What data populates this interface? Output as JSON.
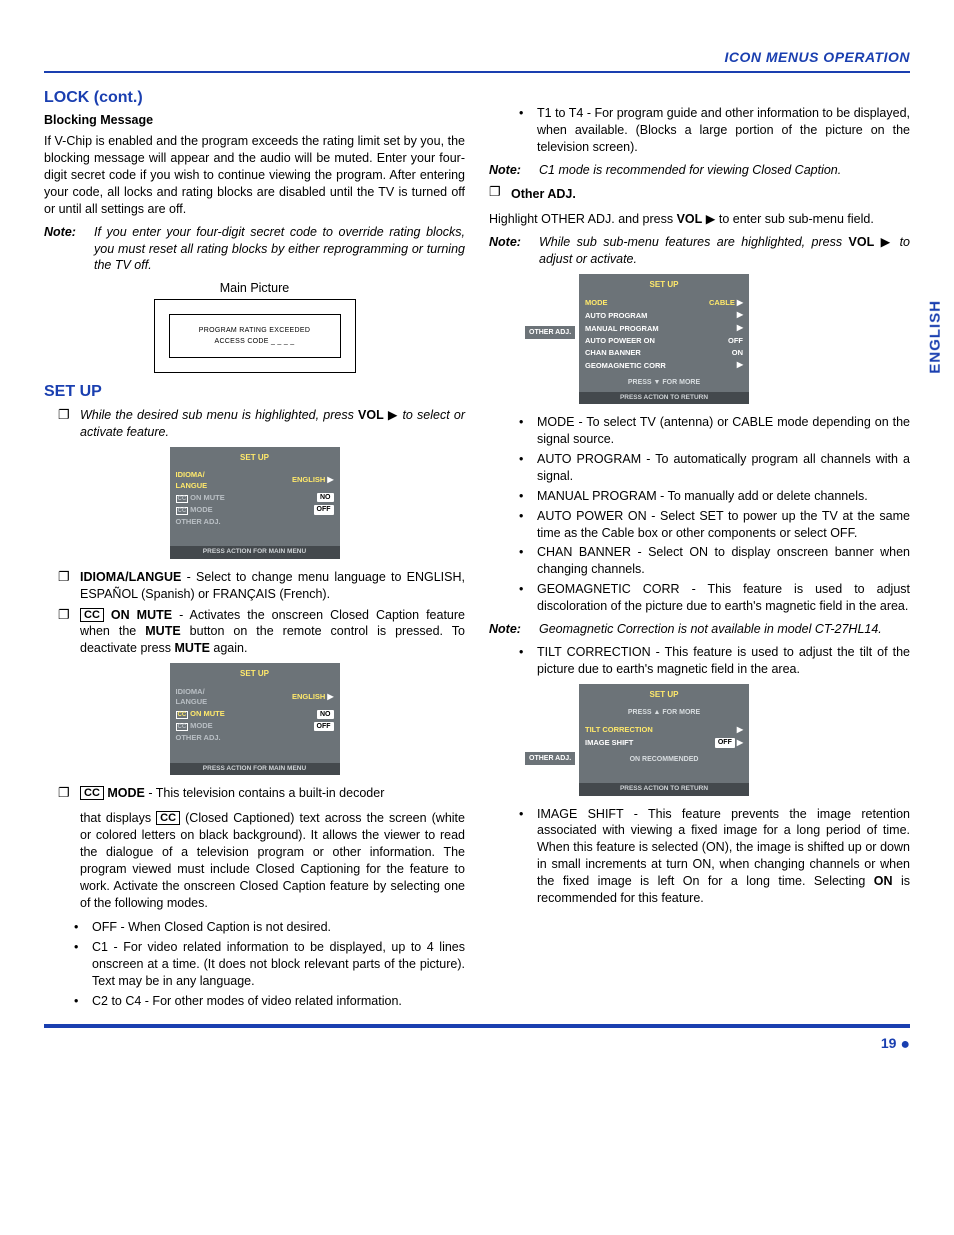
{
  "header": {
    "right": "ICON MENUS OPERATION"
  },
  "side_tab": "ENGLISH",
  "page_number": "19",
  "left": {
    "h_lock": "LOCK (cont.)",
    "h_blocking": "Blocking Message",
    "blocking_para": "If V-Chip is enabled and the program exceeds the rating limit set by you, the blocking message will appear and the audio will be muted. Enter your four-digit secret code if you wish to continue viewing the program. After entering your code, all locks and rating blocks are disabled until the TV is turned off or until all settings are off.",
    "note1_label": "Note:",
    "note1_body": "If you enter your four-digit secret code to override rating blocks, you must reset all rating blocks by either reprogramming or turning the TV off.",
    "main_picture_caption": "Main Picture",
    "fig1_line1": "PROGRAM RATING EXCEEDED",
    "fig1_line2": "ACCESS CODE    _ _ _ _",
    "h_setup": "SET UP",
    "setup_intro_pre": "While the desired sub menu is highlighted, press ",
    "setup_intro_vol": "VOL",
    "setup_intro_post": " to select or activate feature.",
    "osd1": {
      "title": "SET UP",
      "rows": [
        {
          "l": "IDIOMA/\nLANGUE",
          "r": "ENGLISH",
          "tri": true,
          "hl_l": true,
          "hl_r": true
        },
        {
          "cc": true,
          "l": "ON MUTE",
          "pill": "NO",
          "dim": true
        },
        {
          "cc": true,
          "l": "MODE",
          "pill": "OFF",
          "dim": true
        },
        {
          "l": "OTHER ADJ.",
          "dim": true
        }
      ],
      "footer": "PRESS ACTION FOR MAIN MENU"
    },
    "item_idioma_pre": "IDIOMA/LANGUE",
    "item_idioma_body": " - Select to change menu language to ENGLISH, ESPAÑOL (Spanish) or FRANÇAIS (French).",
    "item_onmute_label": "ON MUTE",
    "item_onmute_body_pre": " - Activates the onscreen Closed Caption feature when the ",
    "item_onmute_mute1": "MUTE",
    "item_onmute_body_mid": " button on the remote control is pressed. To deactivate press ",
    "item_onmute_mute2": "MUTE",
    "item_onmute_body_post": " again.",
    "osd2": {
      "title": "SET UP",
      "rows": [
        {
          "l": "IDIOMA/\nLANGUE",
          "r": "ENGLISH",
          "tri": true,
          "dim": false,
          "dim_l": true,
          "hl_r": true
        },
        {
          "cc": true,
          "l": "ON MUTE",
          "pill": "NO",
          "hl_l": true
        },
        {
          "cc": true,
          "l": "MODE",
          "pill": "OFF",
          "dim": true
        },
        {
          "l": "OTHER ADJ.",
          "dim": true
        }
      ],
      "footer": "PRESS ACTION FOR MAIN MENU"
    },
    "item_mode_label": "MODE",
    "item_mode_body1": " - This television contains a built-in decoder",
    "item_mode_body2_pre": "that displays ",
    "item_mode_body2_post": " (Closed Captioned) text across the screen (white or colored letters on black background). It allows the viewer to read the dialogue of a television program or other information. The program viewed must include Closed Captioning for the feature to work. Activate the onscreen Closed Caption feature by selecting one of the following modes.",
    "mode_bullets": [
      "OFF - When Closed Caption is not desired.",
      "C1 - For video related information to be displayed, up to 4 lines onscreen at a time. (It does not block relevant parts of the picture). Text may be in any language.",
      "C2 to C4 - For other modes of video related information."
    ]
  },
  "right": {
    "top_bullet": "T1 to T4 - For program guide and other information to be displayed, when available. (Blocks a large portion of the picture on the television screen).",
    "note_c1_label": "Note:",
    "note_c1_body": "C1 mode is recommended for viewing Closed Caption.",
    "h_other": "Other ADJ.",
    "other_intro_pre": "Highlight OTHER ADJ. and press ",
    "other_intro_vol": "VOL",
    "other_intro_post": " to enter sub sub-menu field.",
    "note_sub_label": "Note:",
    "note_sub_body_pre": "While sub sub-menu features are highlighted, press ",
    "note_sub_vol": "VOL",
    "note_sub_body_post": " to adjust or activate.",
    "osd3": {
      "title": "SET UP",
      "side": "OTHER ADJ.",
      "rows": [
        {
          "l": "MODE",
          "r": "CABLE",
          "tri": true,
          "hl_l": true,
          "hl_r": true
        },
        {
          "l": "AUTO PROGRAM",
          "tri_only": true
        },
        {
          "l": "MANUAL PROGRAM",
          "tri_only": true
        },
        {
          "l": "AUTO POWEER ON",
          "r": "OFF"
        },
        {
          "l": "CHAN BANNER",
          "r": "ON"
        },
        {
          "l": "GEOMAGNETIC CORR",
          "tri_only": true
        }
      ],
      "prefooter": "PRESS   ▼  FOR MORE",
      "footer": "PRESS ACTION TO RETURN"
    },
    "other_bullets": [
      "MODE - To select TV (antenna) or CABLE mode depending on the signal source.",
      "AUTO PROGRAM - To automatically program all channels with a signal.",
      "MANUAL PROGRAM - To manually add or delete channels.",
      "AUTO POWER ON - Select SET to power up the TV at the same time as the Cable box or other components or select OFF.",
      "CHAN BANNER - Select ON to display onscreen banner when changing channels.",
      "GEOMAGNETIC CORR - This feature is used to adjust discoloration of the picture due to earth's magnetic field in the area."
    ],
    "note_geo_label": "Note:",
    "note_geo_body": "Geomagnetic Correction is not available in model CT-27HL14.",
    "tilt_bullet": "TILT CORRECTION - This feature is used to adjust the tilt of the picture due to earth's magnetic field in the area.",
    "osd4": {
      "title": "SET UP",
      "side": "OTHER ADJ.",
      "pretitle": "PRESS ▲ FOR MORE",
      "rows": [
        {
          "l": "TILT  CORRECTION",
          "tri_only": true,
          "hl_l": true
        },
        {
          "l": "IMAGE  SHIFT",
          "pill": "OFF",
          "tri_after": true
        }
      ],
      "mid": "ON RECOMMENDED",
      "footer": "PRESS ACTION TO RETURN"
    },
    "image_shift_pre": "IMAGE SHIFT - This feature prevents the image retention associated with viewing a fixed image for a long period of time. When this feature is selected (ON), the image is shifted up or down in small increments at turn ON, when changing channels or when the fixed image is left On for a long time. Selecting ",
    "image_shift_on": "ON",
    "image_shift_post": " is recommended for this feature."
  }
}
